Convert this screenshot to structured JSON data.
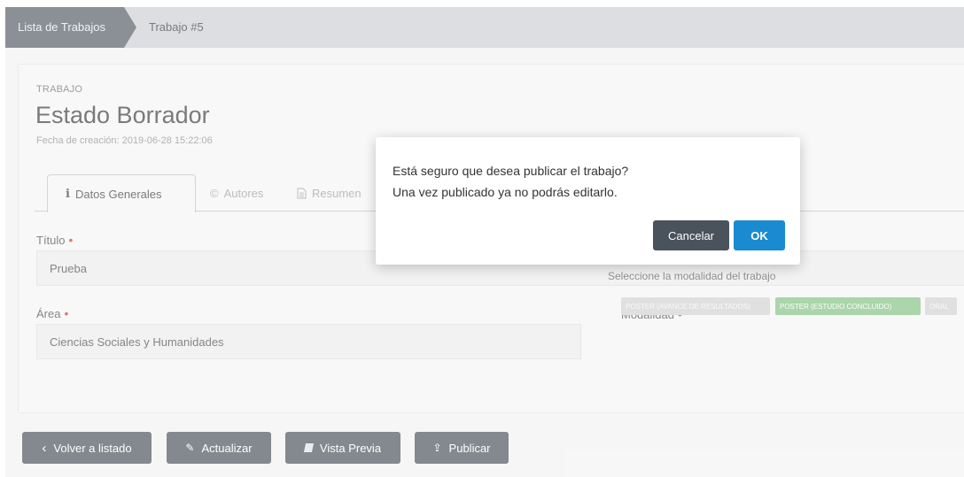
{
  "breadcrumb": {
    "item1": "Lista de Trabajos",
    "item2": "Trabajo #5"
  },
  "header": {
    "section_label": "TRABAJO",
    "title": "Estado Borrador",
    "created": "Fecha de creación: 2019-06-28 15:22:06"
  },
  "tabs": [
    {
      "label": "Datos Generales",
      "icon": "info-icon"
    },
    {
      "label": "Autores",
      "icon": "copyright-icon"
    },
    {
      "label": "Resumen",
      "icon": "document-icon"
    },
    {
      "label": "",
      "icon": "flag-icon"
    }
  ],
  "form": {
    "titulo_label": "Título",
    "titulo_value": "Prueba",
    "area_label": "Área",
    "area_value": "Ciencias Sociales y Humanidades",
    "modalidad_label": "Modalidad",
    "modalidad_hint": "Seleccione la modalidad del trabajo",
    "modalidad_options": [
      {
        "label": "POSTER (AVANCE DE RESULTADOS)",
        "selected": false
      },
      {
        "label": "POSTER (ESTUDIO CONCLUIDO)",
        "selected": true
      },
      {
        "label": "ORAL",
        "selected": false
      }
    ]
  },
  "actions": {
    "back": "Volver a listado",
    "update": "Actualizar",
    "preview": "Vista Previa",
    "publish": "Publicar"
  },
  "modal": {
    "line1": "Está seguro que desea publicar el trabajo?",
    "line2": "Una vez publicado ya no podrás editarlo.",
    "cancel": "Cancelar",
    "ok": "OK"
  },
  "colors": {
    "dark_button": "#434b55",
    "ok_button": "#1a8bd0",
    "cancel_button": "#4a525c",
    "selected_badge": "#5cb85c",
    "required_marker": "#c0392b"
  }
}
